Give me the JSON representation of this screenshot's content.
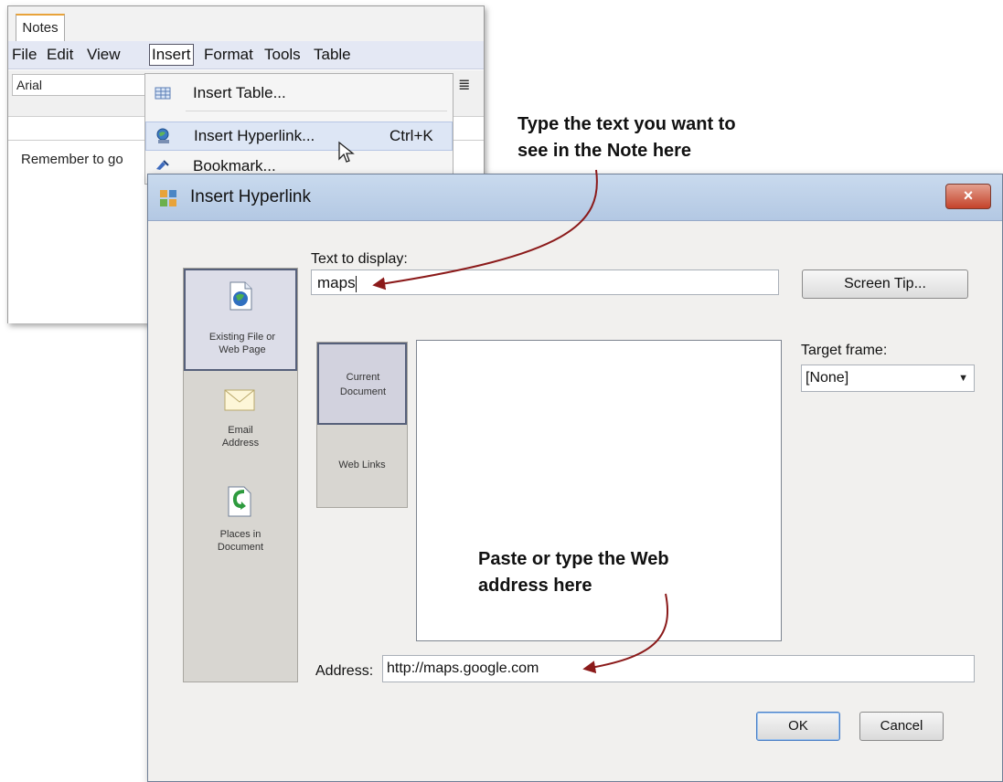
{
  "notes_window": {
    "tab_label": "Notes",
    "menu": [
      "File",
      "Edit",
      "View",
      "Insert",
      "Format",
      "Tools",
      "Table"
    ],
    "font_value": "Arial",
    "body_text": "Remember to go"
  },
  "insert_menu": {
    "items": [
      {
        "label": "Insert Table...",
        "shortcut": ""
      },
      {
        "label": "Insert Hyperlink...",
        "shortcut": "Ctrl+K"
      },
      {
        "label": "Bookmark...",
        "shortcut": ""
      }
    ]
  },
  "dialog": {
    "title": "Insert Hyperlink",
    "close_label": "×",
    "text_to_display_label": "Text to display:",
    "text_to_display_value": "maps",
    "screen_tip_label": "Screen Tip...",
    "link_to": [
      {
        "label_line1": "Existing File or",
        "label_line2": "Web Page",
        "icon": "globe-page-icon"
      },
      {
        "label_line1": "Email",
        "label_line2": "Address",
        "icon": "envelope-icon"
      },
      {
        "label_line1": "Places in",
        "label_line2": "Document",
        "icon": "document-place-icon"
      }
    ],
    "tabs": [
      {
        "label_line1": "Current",
        "label_line2": "Document"
      },
      {
        "label_line1": "Web Links",
        "label_line2": ""
      }
    ],
    "target_frame_label": "Target frame:",
    "target_frame_value": "[None]",
    "address_label": "Address:",
    "address_value": "http://maps.google.com",
    "ok_label": "OK",
    "cancel_label": "Cancel"
  },
  "annotations": {
    "note_callout_line1": "Type the text you want to",
    "note_callout_line2": "see in the Note here",
    "address_callout_line1": "Paste or type the Web",
    "address_callout_line2": "address here"
  },
  "colors": {
    "arrow": "#8b1a1a",
    "title_bar": "#c2d4ec",
    "close_button": "#c4422a",
    "menu_bar": "#e4e8f4"
  }
}
